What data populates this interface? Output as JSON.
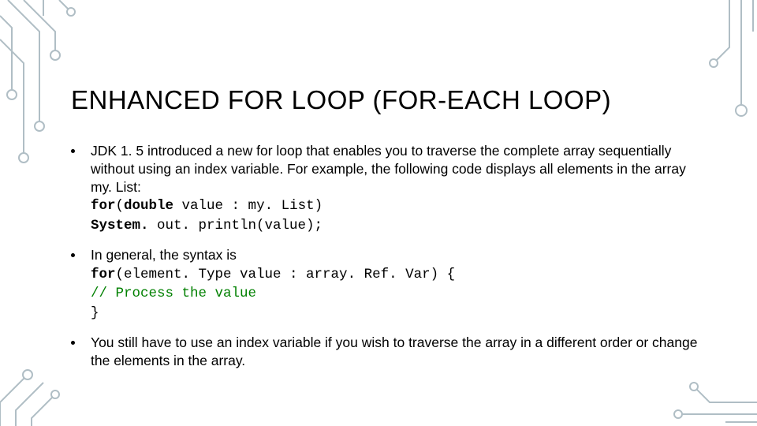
{
  "title": "ENHANCED FOR LOOP (FOR-EACH LOOP)",
  "bullets": {
    "b1": {
      "intro": "JDK 1. 5 introduced a new for loop that enables you to traverse the complete array sequentially without using an index variable. For example, the following code displays all elements in the array my. List:",
      "code1_kw": "for",
      "code1_rest": "(",
      "code1_kw2": "double",
      "code1_tail": " value : my. List)",
      "code2_indent": "  ",
      "code2_kw": "System.",
      "code2_tail": " out. println(value);"
    },
    "b2": {
      "intro": "In general, the syntax is",
      "code1_kw": "for",
      "code1_tail": "(element. Type value : array. Ref. Var) {",
      "comment": " // Process the value",
      "code3": "}"
    },
    "b3": {
      "text": "You still have to use an index variable if you wish to traverse the array in a different order or change the elements in the array."
    }
  }
}
